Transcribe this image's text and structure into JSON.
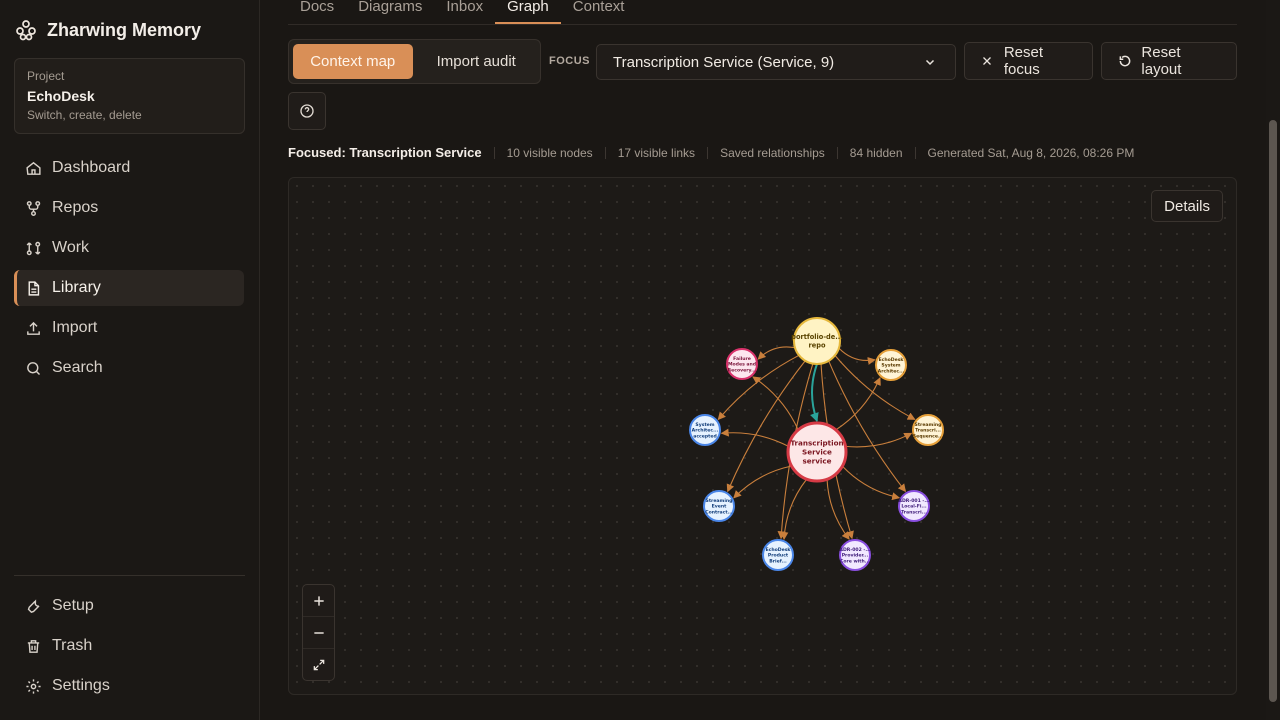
{
  "app": {
    "title": "Zharwing Memory"
  },
  "project": {
    "label": "Project",
    "name": "EchoDesk",
    "subtitle": "Switch, create, delete"
  },
  "nav": {
    "items": [
      {
        "label": "Dashboard",
        "icon": "home-icon"
      },
      {
        "label": "Repos",
        "icon": "repo-icon"
      },
      {
        "label": "Work",
        "icon": "work-icon"
      },
      {
        "label": "Library",
        "icon": "document-icon",
        "active": true
      },
      {
        "label": "Import",
        "icon": "upload-icon"
      },
      {
        "label": "Search",
        "icon": "search-icon"
      }
    ],
    "bottom": [
      {
        "label": "Setup",
        "icon": "wrench-icon"
      },
      {
        "label": "Trash",
        "icon": "trash-icon"
      },
      {
        "label": "Settings",
        "icon": "gear-icon"
      }
    ]
  },
  "tabs": [
    {
      "label": "Docs"
    },
    {
      "label": "Diagrams"
    },
    {
      "label": "Inbox"
    },
    {
      "label": "Graph",
      "active": true
    },
    {
      "label": "Context"
    }
  ],
  "toolbar": {
    "context_map": "Context map",
    "import_audit": "Import audit",
    "focus_label": "FOCUS",
    "focus_value": "Transcription Service (Service, 9)",
    "reset_focus": "Reset focus",
    "reset_layout": "Reset layout"
  },
  "meta": {
    "focused": "Focused: Transcription Service",
    "visible_nodes": "10 visible nodes",
    "visible_links": "17 visible links",
    "relationships": "Saved relationships",
    "hidden": "84 hidden",
    "generated": "Generated Sat, Aug 8, 2026, 08:26 PM"
  },
  "graph": {
    "details_label": "Details",
    "zoom_in": "+",
    "zoom_out": "−",
    "colors": {
      "accent": "#d98f57",
      "edge": "#c97f3c",
      "focus_edge": "#2aa39a"
    },
    "nodes": [
      {
        "id": "focus",
        "lines": [
          "Transcription",
          "Service",
          "service"
        ],
        "kind": "focus",
        "fill": "#fde7e7",
        "stroke": "#d63a45",
        "text": "#7a1520"
      },
      {
        "id": "repo",
        "lines": [
          "portfolio-de...",
          "repo"
        ],
        "kind": "repo",
        "fill": "#fff3c4",
        "stroke": "#e6b83c",
        "text": "#5a4300"
      },
      {
        "id": "failure",
        "lines": [
          "Failure",
          "Modes and",
          "Recovery..."
        ],
        "kind": "doc",
        "fill": "#fde7ef",
        "stroke": "#d9326b",
        "text": "#7a1238"
      },
      {
        "id": "echoarch",
        "lines": [
          "EchoDesk",
          "System",
          "Architec..."
        ],
        "kind": "doc",
        "fill": "#fff4d6",
        "stroke": "#e6a03a",
        "text": "#5a3a00"
      },
      {
        "id": "sysarch",
        "lines": [
          "System",
          "Architec...",
          "accepted"
        ],
        "kind": "doc",
        "fill": "#e6f2ff",
        "stroke": "#4a86e8",
        "text": "#123d7a"
      },
      {
        "id": "streamseq",
        "lines": [
          "Streaming",
          "Transcri...",
          "Sequence..."
        ],
        "kind": "doc",
        "fill": "#fff4d6",
        "stroke": "#e6a03a",
        "text": "#5a3a00"
      },
      {
        "id": "streamevt",
        "lines": [
          "Streaming",
          "Event",
          "Contract..."
        ],
        "kind": "doc",
        "fill": "#e6f2ff",
        "stroke": "#4a86e8",
        "text": "#123d7a"
      },
      {
        "id": "adr001",
        "lines": [
          "ADR-001 -...",
          "Local-Fi...",
          "Transcri..."
        ],
        "kind": "adr",
        "fill": "#f1e8ff",
        "stroke": "#8a4fe0",
        "text": "#3d1a78"
      },
      {
        "id": "brief",
        "lines": [
          "EchoDesk",
          "Product",
          "Brief..."
        ],
        "kind": "doc",
        "fill": "#e6f2ff",
        "stroke": "#4a86e8",
        "text": "#123d7a"
      },
      {
        "id": "adr002",
        "lines": [
          "ADR-002 -...",
          "Provider...",
          "Core with..."
        ],
        "kind": "adr",
        "fill": "#f1e8ff",
        "stroke": "#8a4fe0",
        "text": "#3d1a78"
      }
    ],
    "edges": [
      {
        "from": "repo",
        "to": "focus",
        "focus": true
      },
      {
        "from": "repo",
        "to": "failure"
      },
      {
        "from": "repo",
        "to": "echoarch"
      },
      {
        "from": "repo",
        "to": "sysarch"
      },
      {
        "from": "repo",
        "to": "streamseq"
      },
      {
        "from": "repo",
        "to": "streamevt"
      },
      {
        "from": "repo",
        "to": "adr001"
      },
      {
        "from": "repo",
        "to": "brief"
      },
      {
        "from": "repo",
        "to": "adr002"
      },
      {
        "from": "focus",
        "to": "failure"
      },
      {
        "from": "focus",
        "to": "echoarch"
      },
      {
        "from": "focus",
        "to": "sysarch"
      },
      {
        "from": "focus",
        "to": "streamseq"
      },
      {
        "from": "focus",
        "to": "streamevt"
      },
      {
        "from": "focus",
        "to": "adr001"
      },
      {
        "from": "focus",
        "to": "brief"
      },
      {
        "from": "focus",
        "to": "adr002"
      }
    ]
  }
}
